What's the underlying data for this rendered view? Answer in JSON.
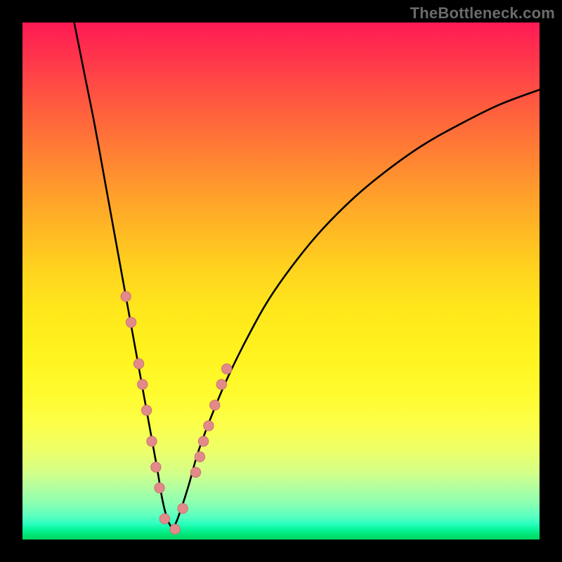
{
  "watermark": "TheBottleneck.com",
  "colors": {
    "curve_stroke": "#000000",
    "marker_fill": "#e28a8a",
    "marker_stroke": "#c97474",
    "frame": "#000000",
    "gradient_stops": [
      "#ff1a55",
      "#ff7a35",
      "#ffd41e",
      "#fffb2f",
      "#b2ffa0",
      "#00d45f"
    ]
  },
  "chart_data": {
    "type": "line",
    "title": "",
    "xlabel": "",
    "ylabel": "",
    "xlim": [
      0,
      100
    ],
    "ylim": [
      0,
      100
    ],
    "grid": false,
    "legend": false,
    "description": "V-shaped bottleneck curve over a red-to-green vertical gradient. Minimum (green zone) around x≈27. Salmon dots mark sample points on both flanks and at the trough.",
    "series": [
      {
        "name": "left_branch",
        "x": [
          10,
          12,
          14,
          16,
          18,
          20,
          22,
          24,
          26,
          27,
          28,
          29
        ],
        "y": [
          100,
          90,
          80,
          69,
          58,
          47,
          36,
          25,
          14,
          8,
          4,
          2
        ]
      },
      {
        "name": "right_branch",
        "x": [
          29,
          30,
          32,
          34,
          37,
          40,
          44,
          48,
          53,
          58,
          64,
          70,
          77,
          84,
          92,
          100
        ],
        "y": [
          2,
          4,
          10,
          17,
          25,
          32,
          40,
          47,
          54,
          60,
          66,
          71,
          76,
          80,
          84,
          87
        ]
      }
    ],
    "markers": {
      "name": "sample_points",
      "x": [
        20,
        21,
        22.5,
        23.2,
        24,
        25,
        25.8,
        26.5,
        27.5,
        29.5,
        31,
        33.5,
        34.3,
        35,
        36,
        37.2,
        38.5,
        39.5
      ],
      "y": [
        47,
        42,
        34,
        30,
        25,
        19,
        14,
        10,
        4,
        2,
        6,
        13,
        16,
        19,
        22,
        26,
        30,
        33
      ]
    }
  }
}
